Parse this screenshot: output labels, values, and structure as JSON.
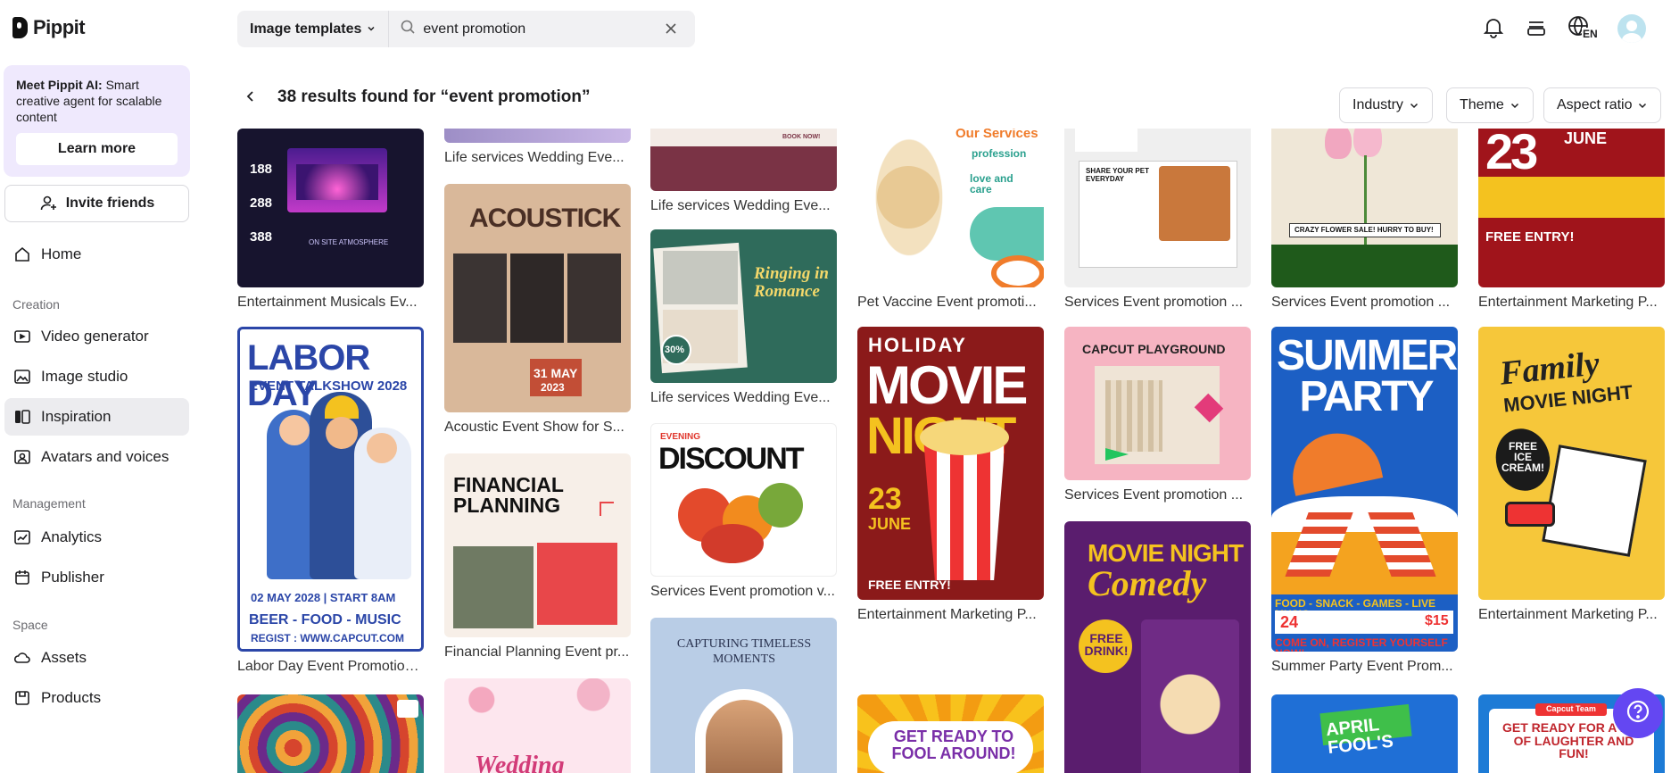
{
  "app": {
    "name": "Pippit"
  },
  "sidebar": {
    "promo": {
      "title": "Meet Pippit AI:",
      "text": " Smart creative agent for scalable content",
      "button": "Learn more"
    },
    "invite": "Invite friends",
    "home": "Home",
    "sections": {
      "creation": "Creation",
      "management": "Management",
      "space": "Space"
    },
    "items": {
      "video": "Video generator",
      "image": "Image studio",
      "inspiration": "Inspiration",
      "avatars": "Avatars and voices",
      "analytics": "Analytics",
      "publisher": "Publisher",
      "assets": "Assets",
      "products": "Products"
    }
  },
  "header": {
    "template_type": "Image templates",
    "search_value": "event promotion",
    "language": "EN"
  },
  "results": {
    "title": "38 results found for “event promotion”"
  },
  "filters": {
    "industry": "Industry",
    "theme": "Theme",
    "aspect": "Aspect ratio"
  },
  "cards": {
    "c1": "Entertainment Musicals Ev...",
    "c2": "Labor Day Event Promotion...",
    "c3": "Life services Wedding Eve...",
    "c4": "Acoustic Event Show for S...",
    "c5": "Financial Planning Event pr...",
    "c6": "Life services Wedding Eve...",
    "c7": "Life services Wedding Eve...",
    "c8": "Services Event promotion v...",
    "c9": "Pet Vaccine Event promoti...",
    "c10": "Entertainment Marketing P...",
    "c11": "Services Event promotion ...",
    "c12": "Services Event promotion ...",
    "c13": "Services Event promotion ...",
    "c14": "Summer Party Event Prom...",
    "c15": "Entertainment Marketing P...",
    "c16": "Entertainment Marketing P..."
  },
  "posters": {
    "ent_nums": [
      "188",
      "288",
      "388"
    ],
    "ent_sub": "ON SITE ATMOSPHERE",
    "labor_title": "LABOR DAY",
    "labor_sub": "EVENT TALKSHOW 2028",
    "labor_date": "02 MAY 2028 | START 8AM",
    "labor_items": "BEER - FOOD - MUSIC",
    "labor_reg": "REGIST : WWW.CAPCUT.COM",
    "acoustic_title": "ACOUSTICK",
    "acoustic_date": "31 MAY",
    "acoustic_year": "2023",
    "fin_title": "FINANCIAL PLANNING",
    "wed_book": "BOOK NOW!",
    "romance": "Ringing in Romance",
    "disc": "30%",
    "discount_pre": "EVENING",
    "discount": "DISCOUNT",
    "capturing": "CAPTURING TIMELESS MOMENTS",
    "pet_title": "Our Services",
    "pet_sub": "profession",
    "pet_love": "love and care",
    "movie_top": "HOLIDAY",
    "movie_big": "MOVIE",
    "movie_night": "NIGHT",
    "movie_date": "23",
    "movie_month": "JUNE",
    "movie_free": "FREE ENTRY!",
    "get_ready": "GET READY TO FOOL AROUND!",
    "share_pet": "SHARE YOUR PET EVERYDAY",
    "playground": "CAPCUT PLAYGROUND",
    "comedy_title": "MOVIE NIGHT",
    "comedy_sub": "Comedy",
    "comedy_free": "FREE DRINK!",
    "flower_sale": "CRAZY FLOWER SALE! HURRY TO BUY!",
    "summer": "SUMMER PARTY",
    "summer_foot": "FOOD - SNACK - GAMES - LIVE MUSIC",
    "summer_come": "COME ON, REGISTER YOURSELF NOW!",
    "summer_date": "24",
    "summer_ticket": "$15",
    "april": "APRIL FOOL'S",
    "june_num": "23",
    "june_month": "JUNE",
    "june_free": "FREE ENTRY!",
    "family": "Family",
    "family_sub": "MOVIE NIGHT",
    "ice_cream": "FREE ICE CREAM!",
    "laughter": "GET READY FOR A DAY OF LAUGHTER AND FUN!",
    "capcut_team": "Capcut Team",
    "wedding": "Wedding"
  },
  "colors": {
    "accent": "#6447f2",
    "promo_bg": "#efe9fd",
    "active_nav": "#ececef"
  }
}
